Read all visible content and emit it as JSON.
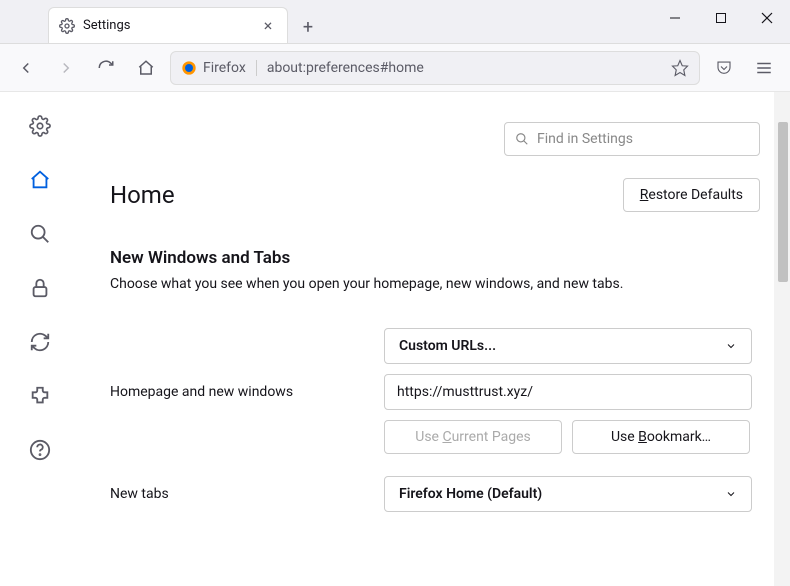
{
  "tab": {
    "title": "Settings"
  },
  "url": {
    "identity": "Firefox",
    "location": "about:preferences#home"
  },
  "search": {
    "placeholder": "Find in Settings"
  },
  "page": {
    "title": "Home",
    "restore_defaults": "Restore Defaults",
    "section_title": "New Windows and Tabs",
    "section_desc": "Choose what you see when you open your homepage, new windows, and new tabs."
  },
  "homepage": {
    "select_label": "Custom URLs...",
    "label": "Homepage and new windows",
    "value": "https://musttrust.xyz/",
    "use_current": "Use Current Pages",
    "use_bookmark": "Use Bookmark…"
  },
  "newtabs": {
    "label": "New tabs",
    "select_label": "Firefox Home (Default)"
  }
}
